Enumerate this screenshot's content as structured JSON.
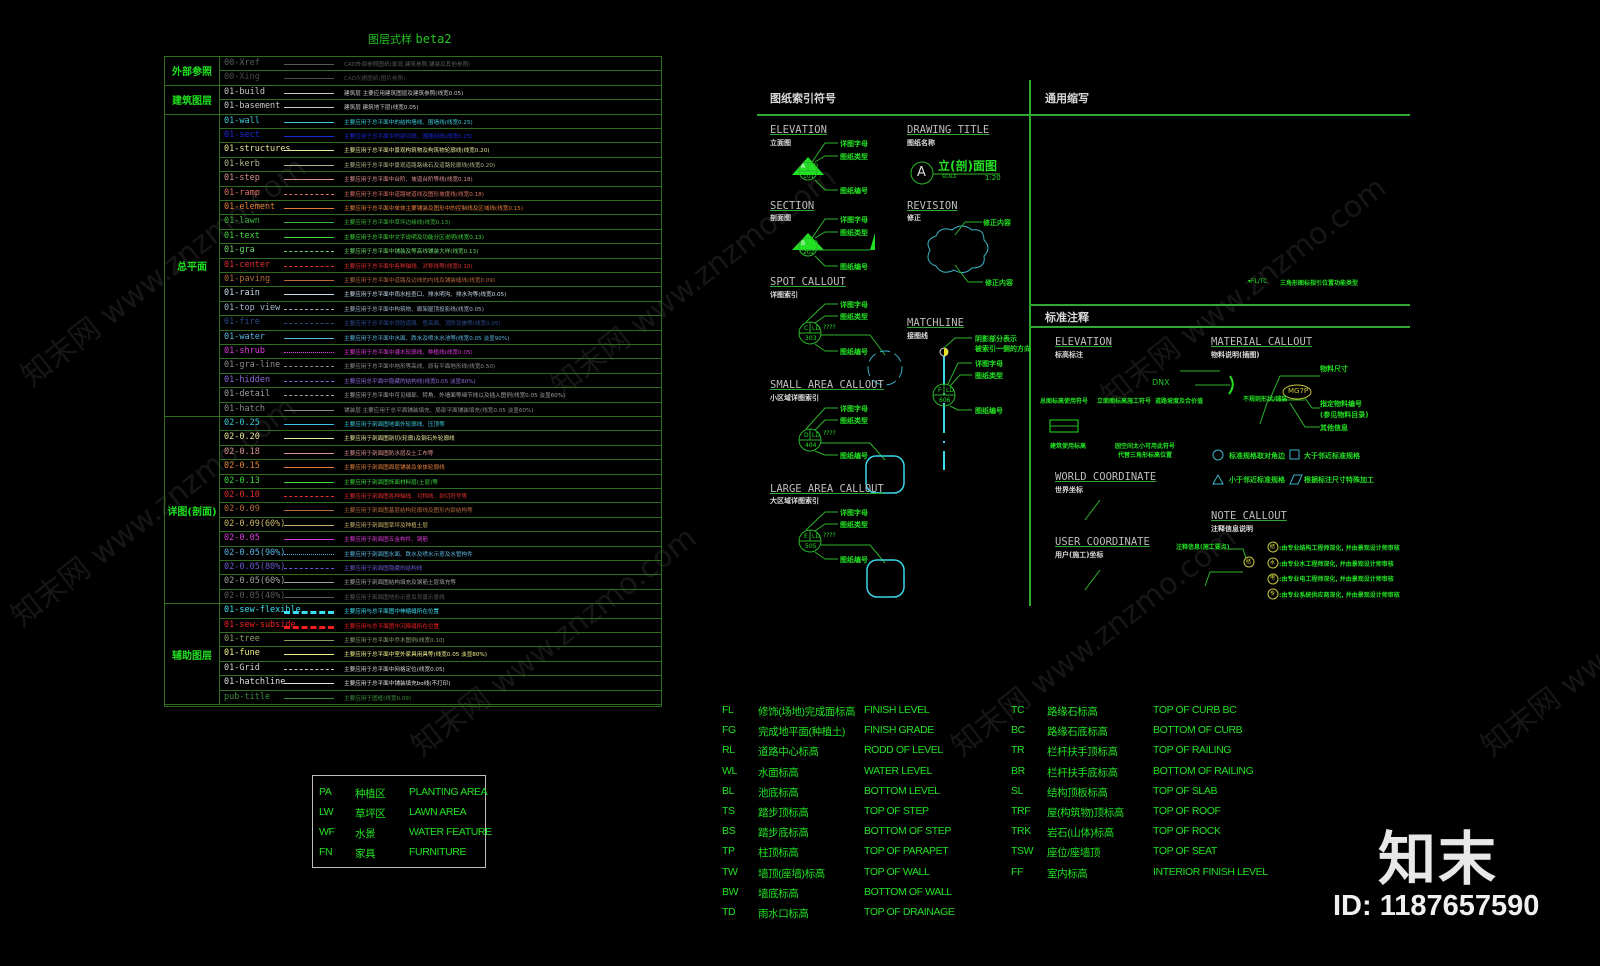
{
  "title": {
    "cn": "图层式样",
    "en": "beta2"
  },
  "layer_groups": [
    {
      "label": "外部参照",
      "rows": 2
    },
    {
      "label": "建筑图层",
      "rows": 2
    },
    {
      "label": "总平面",
      "rows": 21
    },
    {
      "label": "详图(剖面)",
      "rows": 13
    },
    {
      "label": "辅助图层",
      "rows": 7
    }
  ],
  "layers": [
    {
      "name": "00-Xref",
      "color": "#5a5a5a",
      "style": "solid",
      "desc": "CAD外部参照图纸(景观,建筑参照,铺装及其他参照)"
    },
    {
      "name": "00-Xing",
      "color": "#4a4a4a",
      "style": "solid",
      "desc": "CAD光栅图纸(图片参照)"
    },
    {
      "name": "01-build",
      "color": "#c8c8c8",
      "style": "solid",
      "desc": "建筑层 主要应用建筑图层及建筑参照(线宽0.05)"
    },
    {
      "name": "01-basement",
      "color": "#c8c8c8",
      "style": "solid",
      "desc": "建筑层 建筑地下层(线宽0.05)"
    },
    {
      "name": "01-wall",
      "color": "#3cc8d8",
      "style": "solid",
      "desc": "主要应用于总平面中的结构墙线、围墙线(线宽0.25)"
    },
    {
      "name": "01-sect",
      "color": "#1a2ad8",
      "style": "solid",
      "desc": "主要应用于总平面中的剖切线、围墙剖线(线宽0.25)"
    },
    {
      "name": "01-structures",
      "color": "#e6e69a",
      "style": "solid",
      "desc": "主要应用于总平面中景观构筑物及构筑物轮廓线(线宽0.20)"
    },
    {
      "name": "01-kerb",
      "color": "#b4b48c",
      "style": "solid",
      "desc": "主要应用于总平面中景观道路路缘石及道路轮廓线(线宽0.20)"
    },
    {
      "name": "01-step",
      "color": "#d89090",
      "style": "solid",
      "desc": "主要应用于总平面中台阶、坡道台阶等线(线宽0.18)"
    },
    {
      "name": "01-ramp",
      "color": "#d87060",
      "style": "dash",
      "desc": "主要应用于总平面中道路坡道线及图形坡度线(线宽0.18)"
    },
    {
      "name": "01-element",
      "color": "#e0803c",
      "style": "solid",
      "desc": "主要应用于总平面中单体主要铺装及图形中的控制线及区域线(线宽0.15)"
    },
    {
      "name": "01-lawn",
      "color": "#3cb43c",
      "style": "solid",
      "desc": "主要应用于总平面中草坪边缘线(线宽0.13)"
    },
    {
      "name": "01-text",
      "color": "#3cd83c",
      "style": "solid",
      "desc": "主要应用于总平面中文字说明及功能分区说明(线宽0.13)"
    },
    {
      "name": "01-gra",
      "color": "#6cd86c",
      "style": "dashed",
      "desc": "主要应用于总平面中铺装及等高线铺装大样(线宽0.13)"
    },
    {
      "name": "01-center",
      "color": "#e03030",
      "style": "center",
      "desc": "主要应用于总平面中各种轴线、对称线等(线宽0.10)"
    },
    {
      "name": "01-paving",
      "color": "#b46a3c",
      "style": "solid",
      "desc": "主要应用于总平面中道路及边线的内线及铺装缝线(线宽0.09)"
    },
    {
      "name": "01-rain",
      "color": "#c8dcf0",
      "style": "solid",
      "desc": "主要应用于总平面中雨水检查口、排水明沟、排水沟等(线宽0.05)"
    },
    {
      "name": "01-top view",
      "color": "#a0b4c8",
      "style": "dash",
      "desc": "主要应用于总平面中构筑物、廊架屋顶投影线(线宽0.05)"
    },
    {
      "name": "01-fire",
      "color": "#2a4a8c",
      "style": "dash",
      "desc": "主要应用于总平面中消防道路、登高面、消防设施等(线宽0.05)"
    },
    {
      "name": "01-water",
      "color": "#5ab4e0",
      "style": "solid",
      "desc": "主要应用于总平面中水面、跌水及喷水水池等(线宽0.05 淡显90%)"
    },
    {
      "name": "01-shrub",
      "color": "#d83cd8",
      "style": "wavy",
      "desc": "主要应用于总平面中灌木轮廓线、种植线(线宽0.05)"
    },
    {
      "name": "01-gra-line",
      "color": "#8c8c8c",
      "style": "dashed",
      "desc": "主要应用于总平面中地形等高线、原有平面地形线(线宽0.50)"
    },
    {
      "name": "01-hidden",
      "color": "#8a6ad8",
      "style": "dash",
      "desc": "主要应用总平面中隐藏的结构线(线宽0.05 淡显80%)"
    },
    {
      "name": "01-detail",
      "color": "#a0a0a0",
      "style": "dash",
      "desc": "主要应用于总平面中可见细部、转角、外墙面等细节线以及插入图例(线宽0.05 淡显60%)"
    },
    {
      "name": "01-hatch",
      "color": "#8c8c8c",
      "style": "solid",
      "desc": "铺装层 主要应用于总平面铺装填充、局部平面铺装填充(线宽0.05 淡显60%)"
    },
    {
      "name": "02-0.25",
      "color": "#3cc8d8",
      "style": "solid",
      "desc": "主要应用于剖面图地面外轮廓线、压顶等"
    },
    {
      "name": "02-0.20",
      "color": "#e6e69a",
      "style": "solid",
      "desc": "主要应用于剖面图剖切(轮廓)及钢石外轮廓线"
    },
    {
      "name": "02-0.18",
      "color": "#d89090",
      "style": "solid",
      "desc": "主要应用于剖面图防水层及土工布等"
    },
    {
      "name": "02-0.15",
      "color": "#e0803c",
      "style": "solid",
      "desc": "主要应用于剖面图面层铺装及单体轮廓线"
    },
    {
      "name": "02-0.13",
      "color": "#3cd83c",
      "style": "solid",
      "desc": "主要应用于剖面图饰面材料层(土层)等"
    },
    {
      "name": "02-0.10",
      "color": "#e03030",
      "style": "center",
      "desc": "主要应用于剖面图各种轴线、对称线、剖切符号等"
    },
    {
      "name": "02-0.09",
      "color": "#b46a3c",
      "style": "solid",
      "desc": "主要应用于剖面图基层结构轮廓线及图形内部结构等"
    },
    {
      "name": "02-0.09(60%)",
      "color": "#c8b46a",
      "style": "solid",
      "desc": "主要应用于剖面图草坪及种植土层"
    },
    {
      "name": "02-0.05",
      "color": "#d83cd8",
      "style": "solid",
      "desc": "主要应用于剖面图五金构件、钢筋"
    },
    {
      "name": "02-0.05(90%)",
      "color": "#5ab4e0",
      "style": "dotted",
      "desc": "主要应用于剖面图水面、跌水及喷水示意及水管构件"
    },
    {
      "name": "02-0.05(80%)",
      "color": "#6a5ac8",
      "style": "dash",
      "desc": "主要应用于剖面图隐藏的结构线"
    },
    {
      "name": "02-0.05(60%)",
      "color": "#a0a0a0",
      "style": "solid",
      "desc": "主要应用于剖面图结构填充及钢筋土层填充等"
    },
    {
      "name": "02-0.05(40%)",
      "color": "#5a5a5a",
      "style": "solid",
      "desc": "主要应用于剖面图地形示意及背景示意线"
    },
    {
      "name": "01-sew-flexible",
      "color": "#3ce0f0",
      "style": "thickdashdot",
      "desc": "主要应用与总平面图中伸缩缝所在位置"
    },
    {
      "name": "01-sew-subside",
      "color": "#f02020",
      "style": "thickdashdot",
      "desc": "主要应用与总平面图中沉降缝所在位置"
    },
    {
      "name": "01-tree",
      "color": "#8ca06a",
      "style": "solid",
      "desc": "主要应用于总平面中乔木图例(线宽0.10)"
    },
    {
      "name": "01-fune",
      "color": "#f0f08c",
      "style": "solid",
      "desc": "主要应用于总平面中室外家具用具等(线宽0.05 淡显80%)"
    },
    {
      "name": "01-Grid",
      "color": "#d0d0d0",
      "style": "dashed",
      "desc": "主要应用于总平面中网格定位(线宽0.05)"
    },
    {
      "name": "01-hatchline",
      "color": "#e0e0e0",
      "style": "solid",
      "desc": "主要应用于总平面中铺装填充bo线(不打印)"
    },
    {
      "name": "pub-title",
      "color": "#3c8c3c",
      "style": "solid",
      "desc": "主要应用于图框(线宽0.09)"
    }
  ],
  "area_legend": [
    {
      "code": "PA",
      "cn": "种植区",
      "en": "PLANTING AREA"
    },
    {
      "code": "LW",
      "cn": "草坪区",
      "en": "LAWN AREA"
    },
    {
      "code": "WF",
      "cn": "水景",
      "en": "WATER FEATURE"
    },
    {
      "code": "FN",
      "cn": "家具",
      "en": "FURNITURE"
    }
  ],
  "index_symbols": {
    "heading": "图纸索引符号",
    "elevation": {
      "title": "ELEVATION",
      "sub": "立面图",
      "letter": "A",
      "type": "LD",
      "number": "101"
    },
    "drawing_title": {
      "title": "DRAWING TITLE",
      "sub": "图纸名称",
      "letter": "A",
      "name": "立(剖)面图",
      "scale_label": "SCALE",
      "scale": "1:20"
    },
    "section": {
      "title": "SECTION",
      "sub": "剖面图",
      "letter": "B",
      "type": "LD",
      "number": "202"
    },
    "revision": {
      "title": "REVISION",
      "sub": "修正",
      "label_top": "修正内容",
      "label_bottom": "修正内容"
    },
    "spot_callout": {
      "title": "SPOT CALLOUT",
      "sub": "详图索引",
      "letter": "C",
      "type": "LD",
      "number": "303",
      "q": "????"
    },
    "matchline": {
      "title": "MATCHLINE",
      "sub": "接图线",
      "note1": "阴影部分表示",
      "note2": "被索引一侧的方向",
      "letter": "F",
      "type": "LD",
      "number": "606"
    },
    "small_area": {
      "title": "SMALL AREA CALLOUT",
      "sub": "小区域详图索引",
      "letter": "D",
      "type": "LD",
      "number": "404",
      "q": "????"
    },
    "large_area": {
      "title": "LARGE AREA CALLOUT",
      "sub": "大区域详图索引",
      "letter": "E",
      "type": "LD",
      "number": "505",
      "q": "????"
    },
    "leader_letter": "详图字母",
    "leader_type": "图纸类型",
    "leader_number": "图纸编号"
  },
  "abbreviations_heading": "通用缩写",
  "fl_tc": {
    "code": "FL/TC",
    "text": "三角形图标指引位置功能类型"
  },
  "standard_notes": {
    "heading": "标准注释",
    "elevation": {
      "title": "ELEVATION",
      "sub": "标高标注",
      "l1": "总图标高使用符号",
      "l2": "立面图标高施工符号",
      "l3": "道路坡度及合价值",
      "dnx": "DNX",
      "l4": "建筑使用标高",
      "l5a": "园空间太小可用此符号",
      "l5b": "代替三角形标高位置"
    },
    "material": {
      "title": "MATERIAL CALLOUT",
      "sub": "物料说明(插图)",
      "size": "物料尺寸",
      "code": "MG7P",
      "irregular": "不规则形状/铺装",
      "spec1": "指定物料编号",
      "spec2": "(参见物料目录)",
      "other": "其他信息",
      "circle": "标准规格取对角边",
      "square": "大于邻近标准规格",
      "triangle": "小于邻近标准规格",
      "para": "根据标注尺寸特殊加工"
    },
    "world": {
      "title": "WORLD COORDINATE",
      "sub": "世界坐标"
    },
    "user": {
      "title": "USER COORDINATE",
      "sub": "用户(施工)坐标"
    },
    "note": {
      "title": "NOTE CALLOUT",
      "sub": "注释信息说明",
      "info": "注释信息(施工要点)",
      "mark": "结",
      "items": [
        {
          "k": "结",
          "t": ":由专业结构工程师深化, 并由景观设计师审核"
        },
        {
          "k": "水",
          "t": ":由专业水工程师深化, 并由景观设计师审核"
        },
        {
          "k": "电",
          "t": ":由专业电工程师深化, 并由景观设计师审核"
        },
        {
          "k": "专",
          "t": ":由专业系统供应商深化, 并由景观设计师审核"
        }
      ]
    }
  },
  "elevation_abbr_left": [
    {
      "code": "FL",
      "cn": "修饰(场地)完成面标高",
      "en": "FINISH LEVEL"
    },
    {
      "code": "FG",
      "cn": "完成地平面(种植土)",
      "en": "FINISH GRADE"
    },
    {
      "code": "RL",
      "cn": "道路中心标高",
      "en": "RODD OF LEVEL"
    },
    {
      "code": "WL",
      "cn": "水面标高",
      "en": "WATER LEVEL"
    },
    {
      "code": "BL",
      "cn": "池底标高",
      "en": "BOTTOM LEVEL"
    },
    {
      "code": "TS",
      "cn": "踏步顶标高",
      "en": "TOP OF STEP"
    },
    {
      "code": "BS",
      "cn": "踏步底标高",
      "en": "BOTTOM OF STEP"
    },
    {
      "code": "TP",
      "cn": "柱顶标高",
      "en": "TOP OF PARAPET"
    },
    {
      "code": "TW",
      "cn": "墙顶(座墙)标高",
      "en": "TOP OF WALL"
    },
    {
      "code": "BW",
      "cn": "墙底标高",
      "en": "BOTTOM OF WALL"
    },
    {
      "code": "TD",
      "cn": "雨水口标高",
      "en": "TOP OF DRAINAGE"
    }
  ],
  "elevation_abbr_right": [
    {
      "code": "TC",
      "cn": "路缘石标高",
      "en": "TOP OF CURB BC"
    },
    {
      "code": "BC",
      "cn": "路缘石底标高",
      "en": "BOTTOM OF CURB"
    },
    {
      "code": "TR",
      "cn": "栏杆扶手顶标高",
      "en": "TOP OF RAILING"
    },
    {
      "code": "BR",
      "cn": "栏杆扶手底标高",
      "en": "BOTTOM OF RAILING"
    },
    {
      "code": "SL",
      "cn": "结构顶板标高",
      "en": "TOP OF SLAB"
    },
    {
      "code": "TRF",
      "cn": "屋(构筑物)顶标高",
      "en": "TOP OF ROOF"
    },
    {
      "code": "TRK",
      "cn": "岩石(山体)标高",
      "en": "TOP OF ROCK"
    },
    {
      "code": "TSW",
      "cn": "座位/座墙顶",
      "en": "TOP OF SEAT"
    },
    {
      "code": "FF",
      "cn": "室内标高",
      "en": "INTERIOR FINISH LEVEL"
    }
  ],
  "watermark": {
    "text": "知末网 www.znzmo.com",
    "logo": "知末",
    "id": "ID: 1187657590"
  }
}
